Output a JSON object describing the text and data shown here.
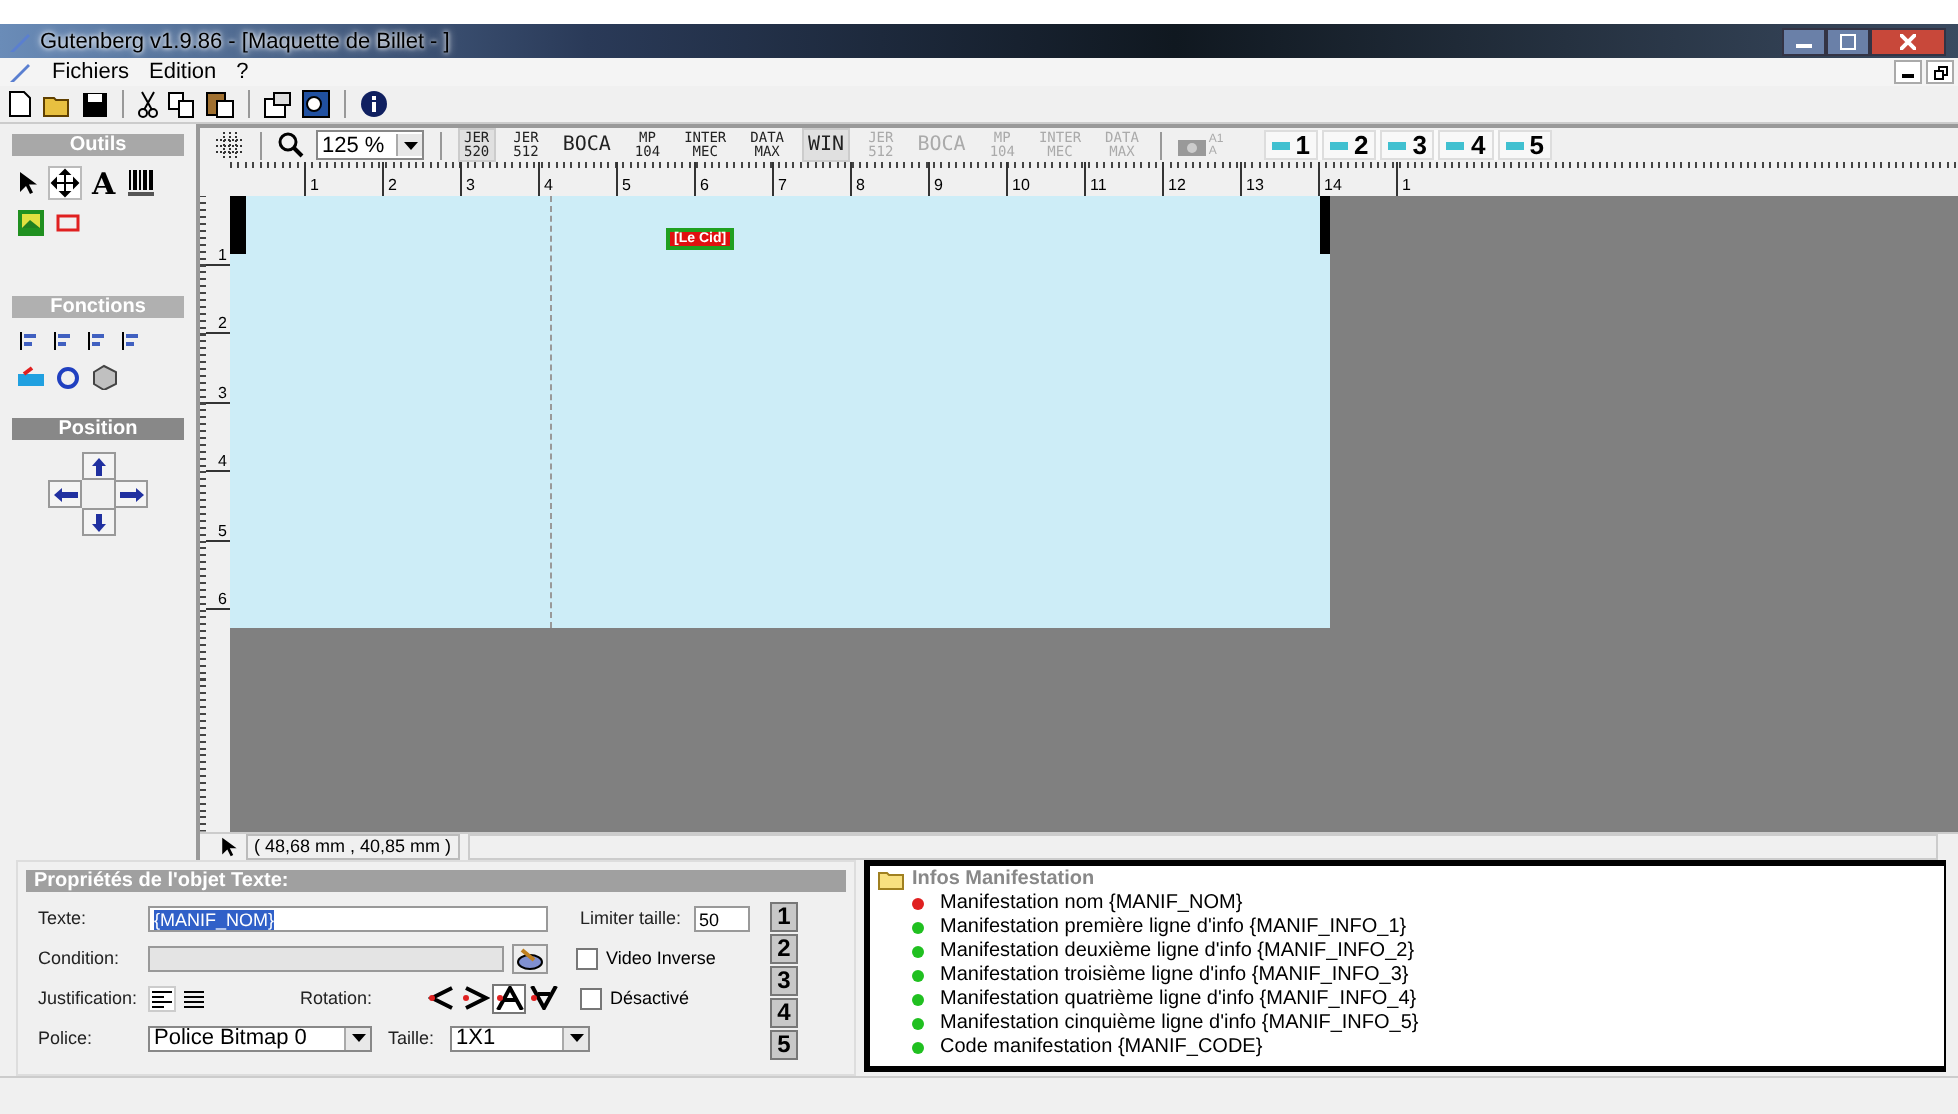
{
  "window": {
    "title": "Gutenberg v1.9.86 - [Maquette de Billet - ]"
  },
  "menu": [
    "Fichiers",
    "Edition",
    "?"
  ],
  "tools_panel": {
    "sections": [
      "Outils",
      "Fonctions",
      "Position"
    ],
    "text_tool_glyph": "A",
    "move_tool_selected": true
  },
  "canvas_toolbar": {
    "zoom": "125 %",
    "printers": [
      {
        "lines": [
          "JER",
          "520"
        ],
        "selected": true,
        "disabled": false
      },
      {
        "lines": [
          "JER",
          "512"
        ],
        "selected": false,
        "disabled": false
      },
      {
        "lines": [
          "BOCA"
        ],
        "selected": false,
        "disabled": false
      },
      {
        "lines": [
          "MP",
          "104"
        ],
        "selected": false,
        "disabled": false
      },
      {
        "lines": [
          "INTER",
          "MEC"
        ],
        "selected": false,
        "disabled": false
      },
      {
        "lines": [
          "DATA",
          "MAX"
        ],
        "selected": false,
        "disabled": false
      },
      {
        "lines": [
          "WIN"
        ],
        "selected": true,
        "disabled": false
      },
      {
        "lines": [
          "JER",
          "512"
        ],
        "selected": false,
        "disabled": true
      },
      {
        "lines": [
          "BOCA"
        ],
        "selected": false,
        "disabled": true
      },
      {
        "lines": [
          "MP",
          "104"
        ],
        "selected": false,
        "disabled": true
      },
      {
        "lines": [
          "INTER",
          "MEC"
        ],
        "selected": false,
        "disabled": true
      },
      {
        "lines": [
          "DATA",
          "MAX"
        ],
        "selected": false,
        "disabled": true
      }
    ],
    "printer_icon_text": [
      "A1",
      "A"
    ],
    "layers": [
      "1",
      "2",
      "3",
      "4",
      "5"
    ]
  },
  "ruler": {
    "horizontal": [
      "1",
      "2",
      "3",
      "4",
      "5",
      "6",
      "7",
      "8",
      "9",
      "10",
      "11",
      "12",
      "13",
      "14",
      "1"
    ],
    "vertical": [
      "1",
      "2",
      "3",
      "4",
      "5",
      "6"
    ]
  },
  "canvas": {
    "elements": [
      {
        "text": "[Le Cid]"
      }
    ]
  },
  "status_bar": {
    "coordinates": "( 48,68 mm , 40,85 mm )"
  },
  "properties": {
    "title": "Propriétés de l'objet Texte:",
    "text_label": "Texte:",
    "text_value": "{MANIF_NOM}",
    "limit_label": "Limiter taille:",
    "limit_value": "50",
    "condition_label": "Condition:",
    "checkboxes": [
      {
        "label": "Video Inverse",
        "checked": false
      },
      {
        "label": "Désactivé",
        "checked": false
      }
    ],
    "justification_label": "Justification:",
    "rotation_label": "Rotation:",
    "rotations": [
      {
        "selected": false
      },
      {
        "selected": false
      },
      {
        "selected": true
      },
      {
        "selected": false
      }
    ],
    "font_label": "Police:",
    "font_value": "Police Bitmap 0",
    "size_label": "Taille:",
    "size_value": "1X1",
    "line_buttons": [
      "1",
      "2",
      "3",
      "4",
      "5"
    ]
  },
  "tree": {
    "folder": "Infos Manifestation",
    "items": [
      {
        "label": "Manifestation nom {MANIF_NOM}",
        "color": "#e02020"
      },
      {
        "label": "Manifestation première ligne d'info {MANIF_INFO_1}",
        "color": "#20c020"
      },
      {
        "label": "Manifestation deuxième ligne d'info {MANIF_INFO_2}",
        "color": "#20c020"
      },
      {
        "label": "Manifestation troisième ligne d'info {MANIF_INFO_3}",
        "color": "#20c020"
      },
      {
        "label": "Manifestation quatrième ligne d'info {MANIF_INFO_4}",
        "color": "#20c020"
      },
      {
        "label": "Manifestation cinquième ligne d'info {MANIF_INFO_5}",
        "color": "#20c020"
      },
      {
        "label": "Code manifestation {MANIF_CODE}",
        "color": "#20c020"
      }
    ]
  }
}
